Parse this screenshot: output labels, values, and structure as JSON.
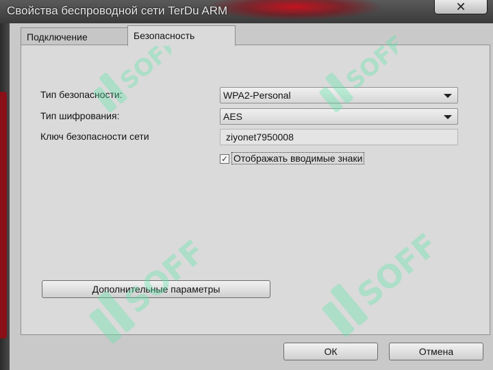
{
  "window": {
    "title": "Свойства беспроводной сети TerDu ARM",
    "close_glyph": "✕"
  },
  "tabs": [
    {
      "label": "Подключение",
      "active": false
    },
    {
      "label": "Безопасность",
      "active": true
    }
  ],
  "security": {
    "type_label": "Тип безопасности:",
    "type_value": "WPA2-Personal",
    "encryption_label": "Тип шифрования:",
    "encryption_value": "AES",
    "key_label": "Ключ безопасности сети",
    "key_value": "ziyonet7950008",
    "show_chars_label": "Отображать вводимые знаки",
    "show_chars_checked": true,
    "advanced_button": "Дополнительные параметры"
  },
  "footer": {
    "ok_button": "ОК",
    "cancel_button": "Отмена"
  },
  "watermark": {
    "text": "SOFF",
    "color": "#59e6a8"
  },
  "colors": {
    "accent_red": "#c2131f",
    "panel_bg": "#dadada"
  }
}
